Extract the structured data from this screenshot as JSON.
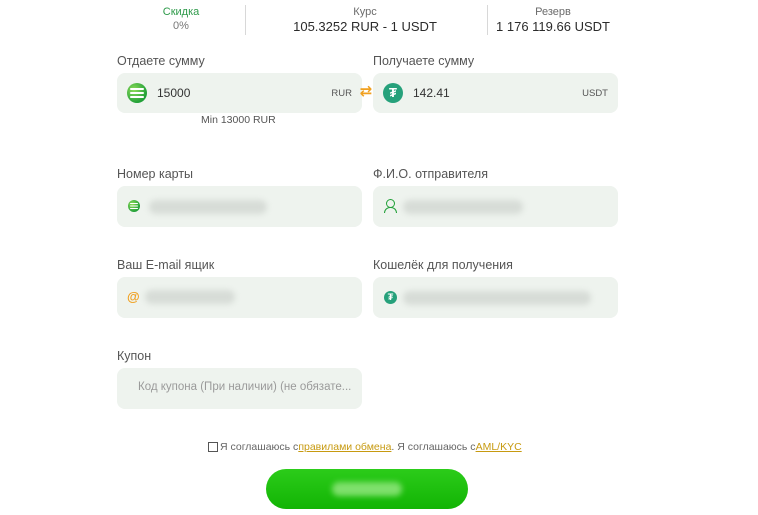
{
  "stats": {
    "discount": {
      "label": "Скидка",
      "value": "0%"
    },
    "rate": {
      "label": "Курс",
      "value": "105.3252 RUR - 1 USDT"
    },
    "reserve": {
      "label": "Резерв",
      "value": "1 176 119.66 USDT"
    }
  },
  "give": {
    "label": "Отдаете сумму",
    "amount": "15000",
    "currency": "RUR",
    "icon": "sberbank-icon",
    "min_note": "Min 13000 RUR"
  },
  "receive": {
    "label": "Получаете сумму",
    "amount": "142.41",
    "currency": "USDT",
    "icon": "tether-icon"
  },
  "card_number": {
    "label": "Номер карты",
    "icon": "sberbank-icon"
  },
  "sender_name": {
    "label": "Ф.И.О. отправителя",
    "icon": "user-icon"
  },
  "email": {
    "label": "Ваш E-mail ящик",
    "icon": "at-icon"
  },
  "wallet": {
    "label": "Кошелёк для получения",
    "icon": "tether-icon"
  },
  "coupon": {
    "label": "Купон",
    "placeholder": "Код купона (При наличии) (не обязате..."
  },
  "agreement": {
    "text_1": "Я соглашаюсь с ",
    "link_rules": "правилами обмена",
    "text_2": ". Я соглашаюсь с ",
    "link_aml": "AML/KYC"
  },
  "colors": {
    "accent_green": "#21a038",
    "field_bg": "#eef3ee",
    "link": "#c79a10",
    "swap_orange": "#f0a020"
  }
}
